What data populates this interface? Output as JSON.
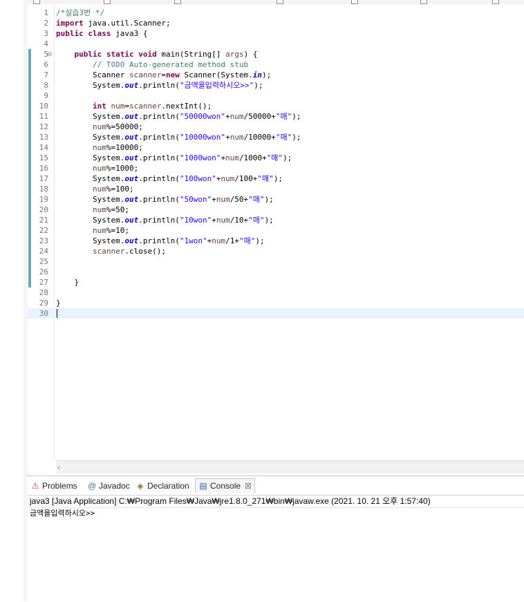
{
  "editor": {
    "lines": [
      {
        "n": "1",
        "segs": [
          {
            "c": "cm",
            "t": "/*실습3번 */"
          }
        ]
      },
      {
        "n": "2",
        "segs": [
          {
            "c": "kw",
            "t": "import"
          },
          {
            "c": "",
            "t": " java.util.Scanner;"
          }
        ]
      },
      {
        "n": "3",
        "segs": [
          {
            "c": "kw",
            "t": "public"
          },
          {
            "c": "",
            "t": " "
          },
          {
            "c": "kw",
            "t": "class"
          },
          {
            "c": "",
            "t": " java3 {"
          }
        ]
      },
      {
        "n": "4",
        "segs": []
      },
      {
        "n": "5",
        "segs": [
          {
            "c": "",
            "t": "    "
          },
          {
            "c": "kw",
            "t": "public"
          },
          {
            "c": "",
            "t": " "
          },
          {
            "c": "kw",
            "t": "static"
          },
          {
            "c": "",
            "t": " "
          },
          {
            "c": "kw",
            "t": "void"
          },
          {
            "c": "",
            "t": " main(String[] "
          },
          {
            "c": "vr",
            "t": "args"
          },
          {
            "c": "",
            "t": ") {"
          }
        ]
      },
      {
        "n": "6",
        "segs": [
          {
            "c": "",
            "t": "        "
          },
          {
            "c": "cm",
            "t": "// "
          },
          {
            "c": "todo",
            "t": "TODO"
          },
          {
            "c": "cm",
            "t": " Auto-generated method stub"
          }
        ]
      },
      {
        "n": "7",
        "segs": [
          {
            "c": "",
            "t": "        Scanner "
          },
          {
            "c": "vr",
            "t": "scanner"
          },
          {
            "c": "",
            "t": "="
          },
          {
            "c": "kw",
            "t": "new"
          },
          {
            "c": "",
            "t": " Scanner(System."
          },
          {
            "c": "st",
            "t": "in"
          },
          {
            "c": "",
            "t": ");"
          }
        ]
      },
      {
        "n": "8",
        "segs": [
          {
            "c": "",
            "t": "        System."
          },
          {
            "c": "st",
            "t": "out"
          },
          {
            "c": "",
            "t": ".println("
          },
          {
            "c": "str",
            "t": "\"금액을입력하시오>>\""
          },
          {
            "c": "",
            "t": ");"
          }
        ]
      },
      {
        "n": "9",
        "segs": []
      },
      {
        "n": "10",
        "segs": [
          {
            "c": "",
            "t": "        "
          },
          {
            "c": "kw",
            "t": "int"
          },
          {
            "c": "",
            "t": " "
          },
          {
            "c": "vr",
            "t": "num"
          },
          {
            "c": "",
            "t": "="
          },
          {
            "c": "vr",
            "t": "scanner"
          },
          {
            "c": "",
            "t": ".nextInt();"
          }
        ]
      },
      {
        "n": "11",
        "segs": [
          {
            "c": "",
            "t": "        System."
          },
          {
            "c": "st",
            "t": "out"
          },
          {
            "c": "",
            "t": ".println("
          },
          {
            "c": "str",
            "t": "\"50000won\""
          },
          {
            "c": "",
            "t": "+"
          },
          {
            "c": "vr",
            "t": "num"
          },
          {
            "c": "",
            "t": "/50000+"
          },
          {
            "c": "str",
            "t": "\"매\""
          },
          {
            "c": "",
            "t": ");"
          }
        ]
      },
      {
        "n": "12",
        "segs": [
          {
            "c": "",
            "t": "        "
          },
          {
            "c": "vr",
            "t": "num"
          },
          {
            "c": "",
            "t": "%=50000;"
          }
        ]
      },
      {
        "n": "13",
        "segs": [
          {
            "c": "",
            "t": "        System."
          },
          {
            "c": "st",
            "t": "out"
          },
          {
            "c": "",
            "t": ".println("
          },
          {
            "c": "str",
            "t": "\"10000won\""
          },
          {
            "c": "",
            "t": "+"
          },
          {
            "c": "vr",
            "t": "num"
          },
          {
            "c": "",
            "t": "/10000+"
          },
          {
            "c": "str",
            "t": "\"매\""
          },
          {
            "c": "",
            "t": ");"
          }
        ]
      },
      {
        "n": "14",
        "segs": [
          {
            "c": "",
            "t": "        "
          },
          {
            "c": "vr",
            "t": "num"
          },
          {
            "c": "",
            "t": "%=10000;"
          }
        ]
      },
      {
        "n": "15",
        "segs": [
          {
            "c": "",
            "t": "        System."
          },
          {
            "c": "st",
            "t": "out"
          },
          {
            "c": "",
            "t": ".println("
          },
          {
            "c": "str",
            "t": "\"1000won\""
          },
          {
            "c": "",
            "t": "+"
          },
          {
            "c": "vr",
            "t": "num"
          },
          {
            "c": "",
            "t": "/1000+"
          },
          {
            "c": "str",
            "t": "\"매\""
          },
          {
            "c": "",
            "t": ");"
          }
        ]
      },
      {
        "n": "16",
        "segs": [
          {
            "c": "",
            "t": "        "
          },
          {
            "c": "vr",
            "t": "num"
          },
          {
            "c": "",
            "t": "%=1000;"
          }
        ]
      },
      {
        "n": "17",
        "segs": [
          {
            "c": "",
            "t": "        System."
          },
          {
            "c": "st",
            "t": "out"
          },
          {
            "c": "",
            "t": ".println("
          },
          {
            "c": "str",
            "t": "\"100won\""
          },
          {
            "c": "",
            "t": "+"
          },
          {
            "c": "vr",
            "t": "num"
          },
          {
            "c": "",
            "t": "/100+"
          },
          {
            "c": "str",
            "t": "\"매\""
          },
          {
            "c": "",
            "t": ");"
          }
        ]
      },
      {
        "n": "18",
        "segs": [
          {
            "c": "",
            "t": "        "
          },
          {
            "c": "vr",
            "t": "num"
          },
          {
            "c": "",
            "t": "%=100;"
          }
        ]
      },
      {
        "n": "19",
        "segs": [
          {
            "c": "",
            "t": "        System."
          },
          {
            "c": "st",
            "t": "out"
          },
          {
            "c": "",
            "t": ".println("
          },
          {
            "c": "str",
            "t": "\"50won\""
          },
          {
            "c": "",
            "t": "+"
          },
          {
            "c": "vr",
            "t": "num"
          },
          {
            "c": "",
            "t": "/50+"
          },
          {
            "c": "str",
            "t": "\"매\""
          },
          {
            "c": "",
            "t": ");"
          }
        ]
      },
      {
        "n": "20",
        "segs": [
          {
            "c": "",
            "t": "        "
          },
          {
            "c": "vr",
            "t": "num"
          },
          {
            "c": "",
            "t": "%=50;"
          }
        ]
      },
      {
        "n": "21",
        "segs": [
          {
            "c": "",
            "t": "        System."
          },
          {
            "c": "st",
            "t": "out"
          },
          {
            "c": "",
            "t": ".println("
          },
          {
            "c": "str",
            "t": "\"10won\""
          },
          {
            "c": "",
            "t": "+"
          },
          {
            "c": "vr",
            "t": "num"
          },
          {
            "c": "",
            "t": "/10+"
          },
          {
            "c": "str",
            "t": "\"매\""
          },
          {
            "c": "",
            "t": ");"
          }
        ]
      },
      {
        "n": "22",
        "segs": [
          {
            "c": "",
            "t": "        "
          },
          {
            "c": "vr",
            "t": "num"
          },
          {
            "c": "",
            "t": "%=10;"
          }
        ]
      },
      {
        "n": "23",
        "segs": [
          {
            "c": "",
            "t": "        System."
          },
          {
            "c": "st",
            "t": "out"
          },
          {
            "c": "",
            "t": ".println("
          },
          {
            "c": "str",
            "t": "\"1won\""
          },
          {
            "c": "",
            "t": "+"
          },
          {
            "c": "vr",
            "t": "num"
          },
          {
            "c": "",
            "t": "/1+"
          },
          {
            "c": "str",
            "t": "\"매\""
          },
          {
            "c": "",
            "t": ");"
          }
        ]
      },
      {
        "n": "24",
        "segs": [
          {
            "c": "",
            "t": "        "
          },
          {
            "c": "vr",
            "t": "scanner"
          },
          {
            "c": "",
            "t": ".close();"
          }
        ]
      },
      {
        "n": "25",
        "segs": []
      },
      {
        "n": "26",
        "segs": []
      },
      {
        "n": "27",
        "segs": [
          {
            "c": "",
            "t": "    }"
          }
        ]
      },
      {
        "n": "28",
        "segs": []
      },
      {
        "n": "29",
        "segs": [
          {
            "c": "",
            "t": "}"
          }
        ]
      },
      {
        "n": "30",
        "segs": []
      }
    ]
  },
  "views": {
    "tabs": [
      {
        "label": "Problems",
        "icon": "problems-icon",
        "glyph": "⚠"
      },
      {
        "label": "Javadoc",
        "icon": "javadoc-icon",
        "glyph": "@"
      },
      {
        "label": "Declaration",
        "icon": "declaration-icon",
        "glyph": "◈"
      },
      {
        "label": "Console",
        "icon": "console-icon",
        "glyph": "▤"
      }
    ],
    "console_close": "☒",
    "console_description": "java3 [Java Application] C:₩Program Files₩Java₩jre1.8.0_271₩bin₩javaw.exe  (2021. 10. 21 오후 1:57:40)",
    "console_output": "금액을입력하시오>>"
  },
  "colors": {
    "keyword": "#7f0055",
    "comment": "#3f7f5f",
    "string": "#2a00ff",
    "static_field": "#0000c0",
    "current_line": "#e8f2fe"
  }
}
